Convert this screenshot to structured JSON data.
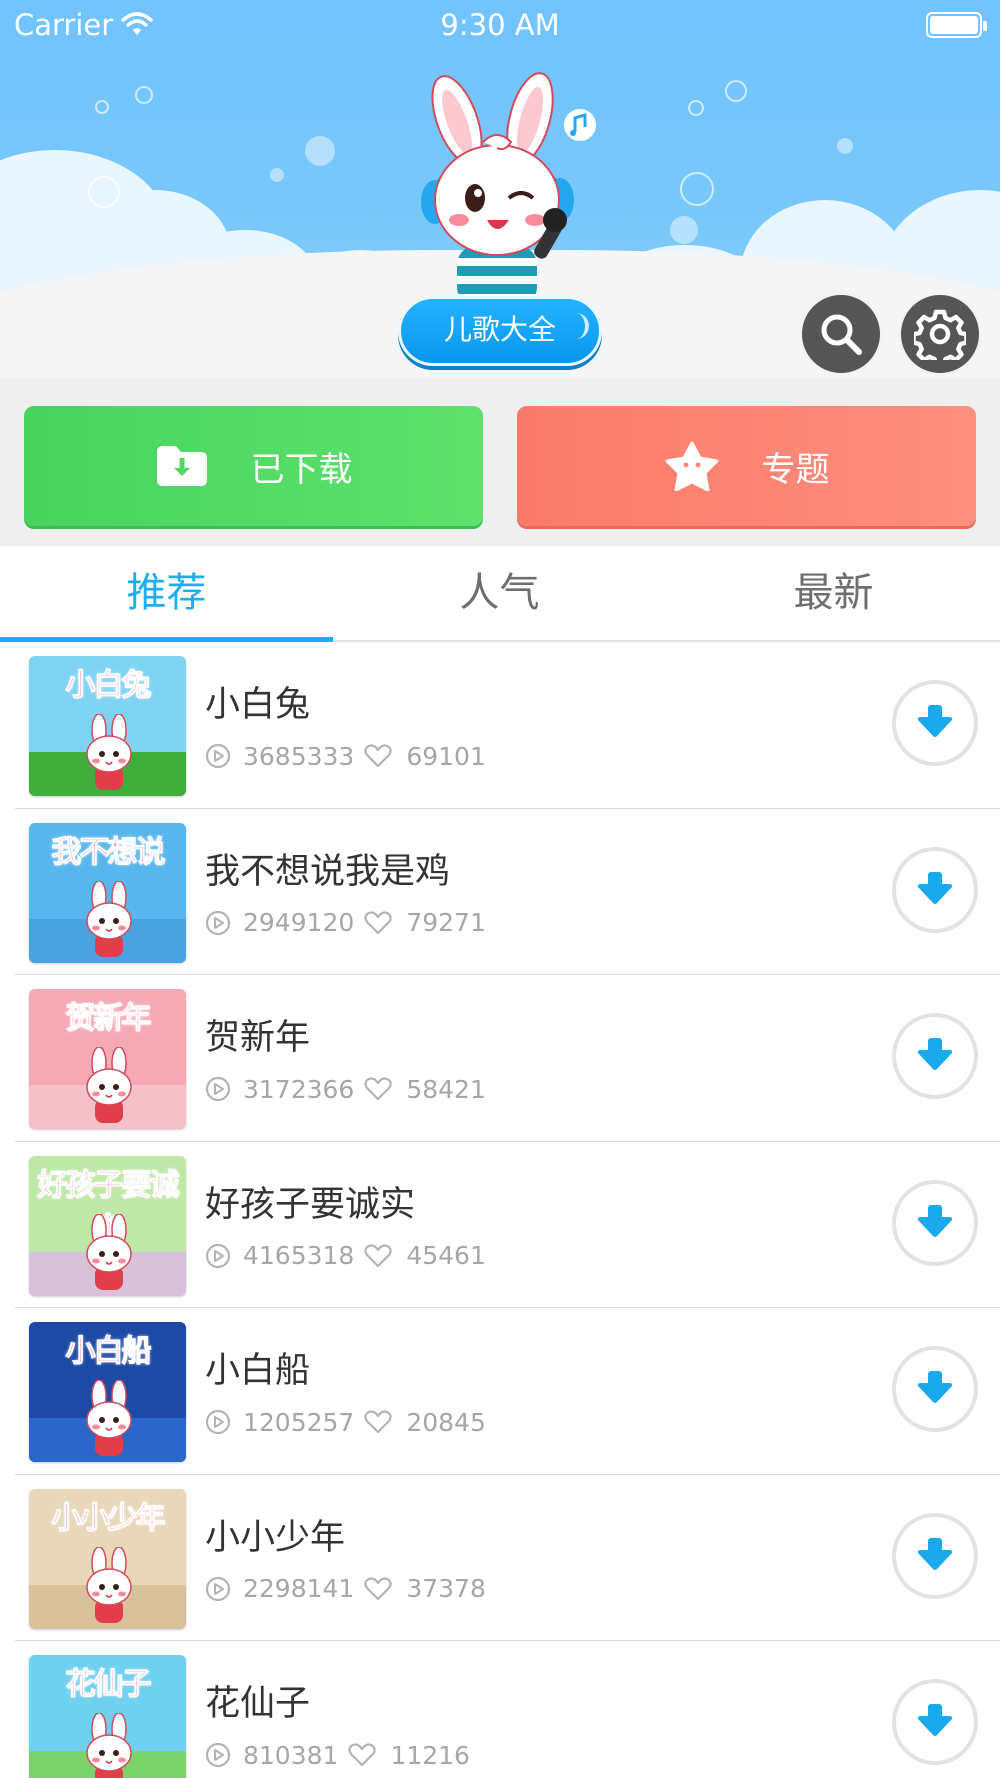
{
  "status_bar": {
    "carrier": "Carrier",
    "time": "9:30 AM"
  },
  "header": {
    "title": "儿歌大全",
    "sky_color": "#72c3ff",
    "pill_color": "#1aa7f5",
    "search_icon": "search-icon",
    "settings_icon": "gear-icon"
  },
  "actions": {
    "downloaded_label": "已下载",
    "downloaded_icon": "folder-download-icon",
    "downloaded_color": "#55dd66",
    "topics_label": "专题",
    "topics_icon": "star-icon",
    "topics_color": "#fd8676"
  },
  "tabs": [
    {
      "label": "推荐",
      "active": true
    },
    {
      "label": "人气",
      "active": false
    },
    {
      "label": "最新",
      "active": false
    }
  ],
  "accent_color": "#1eaef0",
  "songs": [
    {
      "title": "小白兔",
      "thumb_text": "小白兔",
      "plays": "3685333",
      "likes": "69101",
      "thumb_bg": "#7fd3f2",
      "thumb_ground": "#3fae3a"
    },
    {
      "title": "我不想说我是鸡",
      "thumb_text": "我不想说",
      "plays": "2949120",
      "likes": "79271",
      "thumb_bg": "#58b6ee",
      "thumb_ground": "#4aa3e0"
    },
    {
      "title": "贺新年",
      "thumb_text": "贺新年",
      "plays": "3172366",
      "likes": "58421",
      "thumb_bg": "#f6a9b5",
      "thumb_ground": "#f4c1c7"
    },
    {
      "title": "好孩子要诚实",
      "thumb_text": "好孩子要诚实",
      "plays": "4165318",
      "likes": "45461",
      "thumb_bg": "#bfe8a8",
      "thumb_ground": "#d7c2d9"
    },
    {
      "title": "小白船",
      "thumb_text": "小白船",
      "plays": "1205257",
      "likes": "20845",
      "thumb_bg": "#1c4aa5",
      "thumb_ground": "#2b66c9"
    },
    {
      "title": "小小少年",
      "thumb_text": "小小少年",
      "plays": "2298141",
      "likes": "37378",
      "thumb_bg": "#e8d7b8",
      "thumb_ground": "#d9c29b"
    },
    {
      "title": "花仙子",
      "thumb_text": "花仙子",
      "plays": "810381",
      "likes": "11216",
      "thumb_bg": "#6fd0f0",
      "thumb_ground": "#7bd36a"
    }
  ]
}
